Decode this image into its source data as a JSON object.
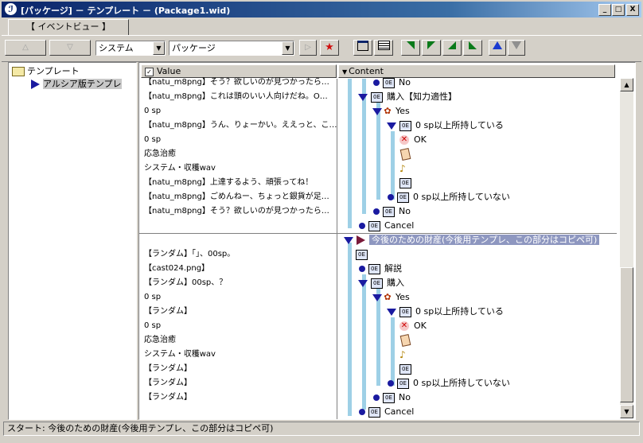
{
  "window": {
    "title": "[パッケージ] － テンプレート － (Package1.wid)",
    "min_label": "_",
    "max_label": "□",
    "close_label": "X"
  },
  "tabs": [
    "【 イベントビュー 】"
  ],
  "toolbar": {
    "up_label": "△",
    "down_label": "▽",
    "system_value": "システム",
    "package_value": "パッケージ",
    "play_label": "▷",
    "star_label": "★"
  },
  "tree": {
    "root": "テンプレート",
    "child": "アルシア版テンプレ"
  },
  "columns": {
    "value": "Value",
    "content": "Content"
  },
  "section1": {
    "values": [
      "【natu_m8png】そう？欲しいのが見つかったら…",
      "【natu_m8png】これは頭のいい人向けだね。O…",
      "0 sp",
      "【natu_m8png】うん、りょーかい。ええっと、こ…",
      "0 sp",
      "応急治癒",
      "システム・収穫wav",
      "【natu_m8png】上達するよう、頑張ってね！",
      "【natu_m8png】ごめんねー、ちょっと銀貨が足…",
      "【natu_m8png】そう？欲しいのが見つかったら…"
    ],
    "contents": [
      "No",
      "購入【知力適性】",
      "Yes",
      "0 sp以上所持している",
      "OK",
      "0 sp以上所持していない",
      "No",
      "Cancel"
    ]
  },
  "section2": {
    "values": [
      "【ランダム】「」、00sp。",
      "【cast024.png】",
      "【ランダム】00sp、？",
      "0 sp",
      "【ランダム】",
      "0 sp",
      "応急治癒",
      "システム・収穫wav",
      "【ランダム】",
      "【ランダム】",
      "【ランダム】"
    ],
    "title": "今後のための財産(今後用テンプレ、この部分はコピペ可)",
    "contents": [
      "解説",
      "購入",
      "Yes",
      "0 sp以上所持している",
      "OK",
      "0 sp以上所持していない",
      "No",
      "Cancel"
    ]
  },
  "status": "スタート: 今後のための財産(今後用テンプレ、この部分はコピペ可)",
  "colors": {
    "title_start": "#0a246a",
    "selection": "#8e97c0",
    "tree_lines": "#9ed0e6",
    "markers": "#1a1aa0"
  }
}
